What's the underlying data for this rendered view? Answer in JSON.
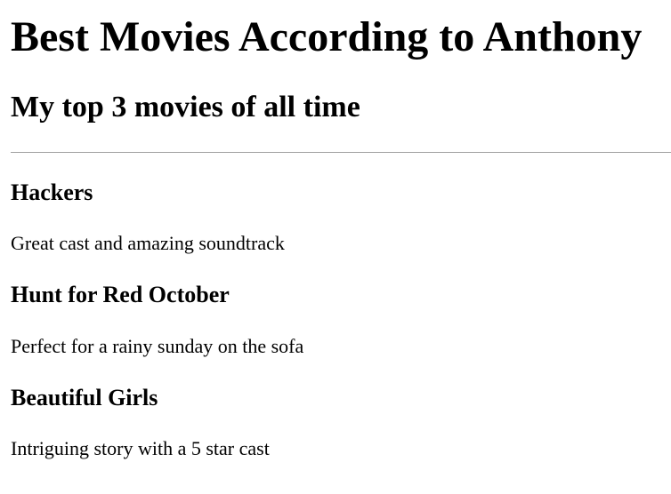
{
  "page": {
    "title": "Best Movies According to Anthony",
    "subtitle": "My top 3 movies of all time"
  },
  "movies": [
    {
      "title": "Hackers",
      "description": "Great cast and amazing soundtrack"
    },
    {
      "title": "Hunt for Red October",
      "description": "Perfect for a rainy sunday on the sofa"
    },
    {
      "title": "Beautiful Girls",
      "description": "Intriguing story with a 5 star cast"
    }
  ]
}
